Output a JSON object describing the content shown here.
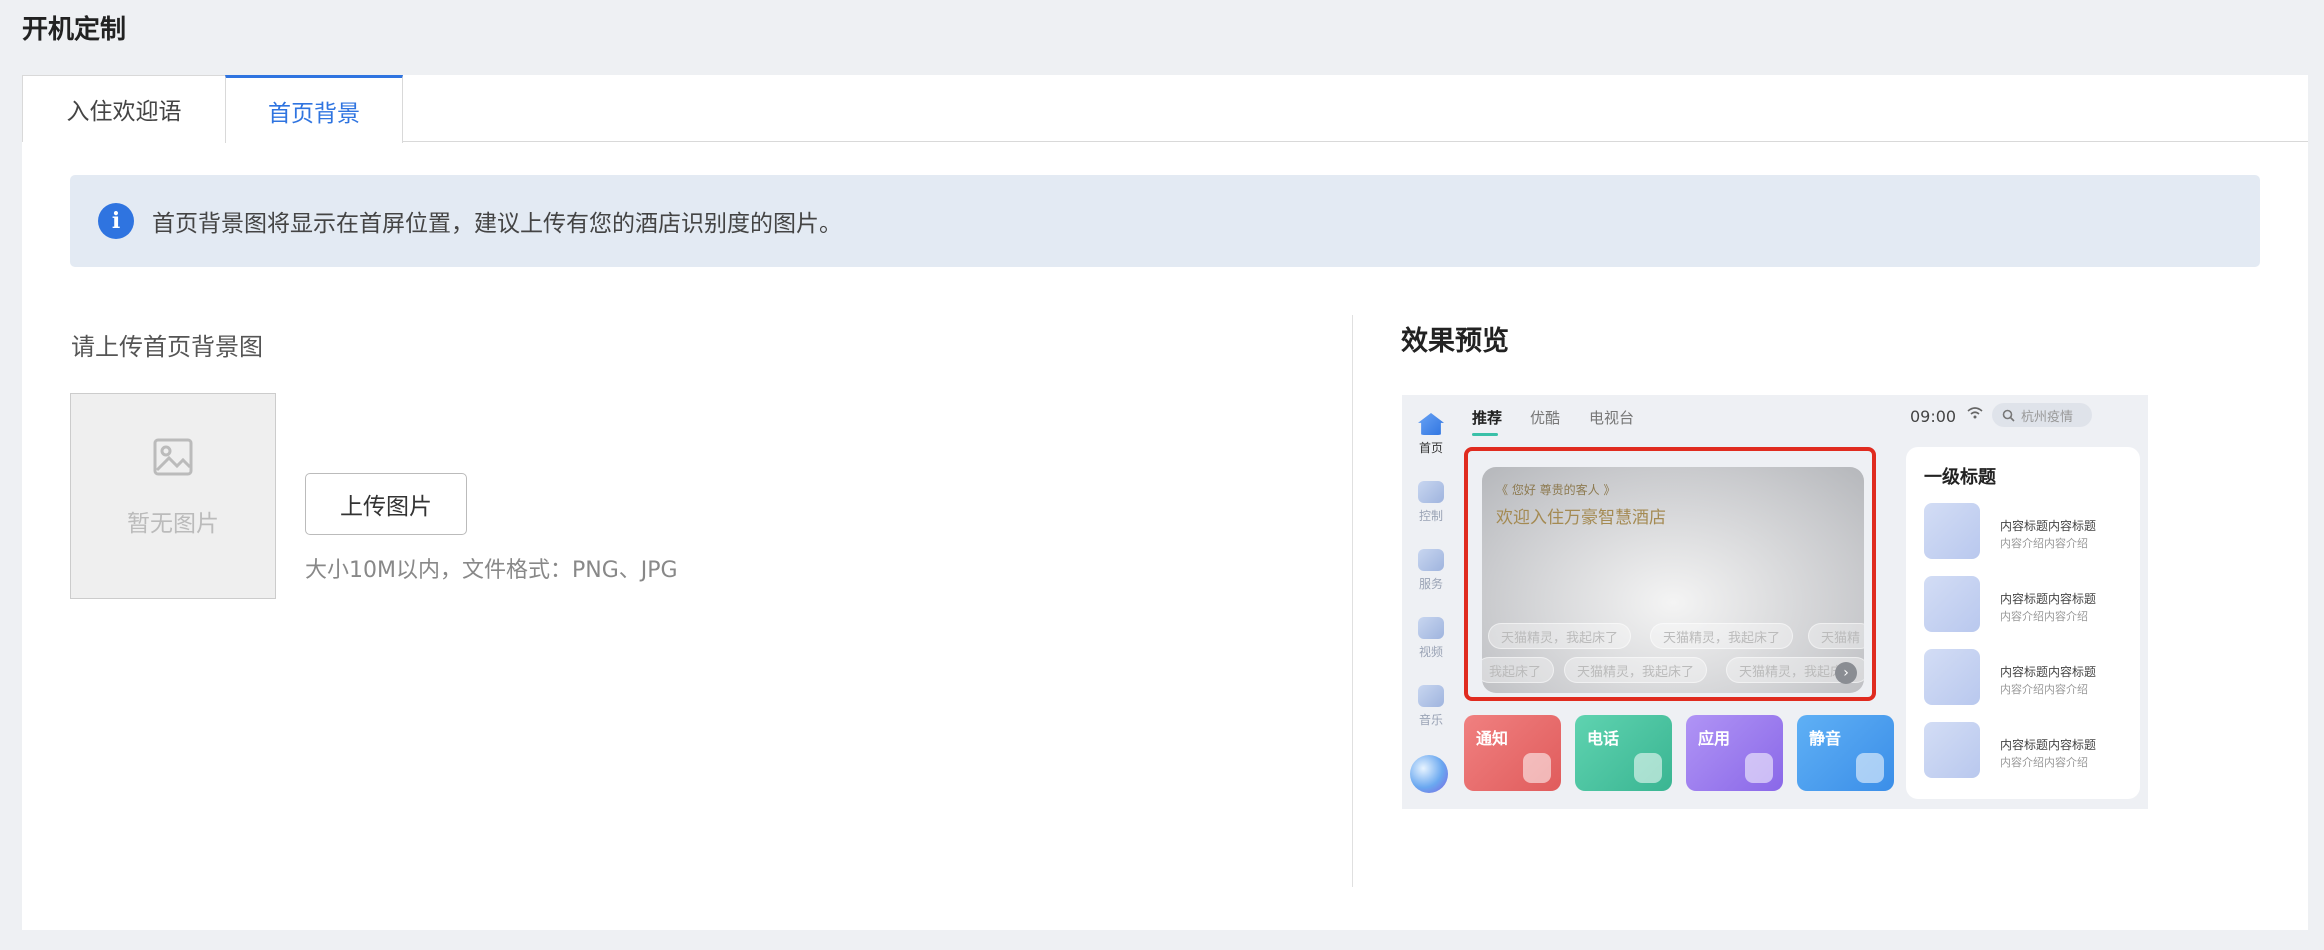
{
  "page": {
    "title": "开机定制"
  },
  "tabs": [
    {
      "label": "入住欢迎语",
      "active": false
    },
    {
      "label": "首页背景",
      "active": true
    }
  ],
  "notice": {
    "icon": "info-icon",
    "text": "首页背景图将显示在首屏位置，建议上传有您的酒店识别度的图片。"
  },
  "upload": {
    "label": "请上传首页背景图",
    "placeholder_text": "暂无图片",
    "button_label": "上传图片",
    "hint": "大小10M以内，文件格式：PNG、JPG"
  },
  "preview": {
    "title": "效果预览",
    "sidebar": [
      {
        "label": "首页",
        "icon": "home-icon"
      },
      {
        "label": "控制",
        "icon": "control-icon"
      },
      {
        "label": "服务",
        "icon": "service-icon"
      },
      {
        "label": "视频",
        "icon": "video-icon"
      },
      {
        "label": "音乐",
        "icon": "music-icon"
      }
    ],
    "top_tabs": [
      "推荐",
      "优酷",
      "电视台"
    ],
    "time": "09:00",
    "search_text": "杭州疫情",
    "banner": {
      "greeting": "《 您好 尊贵的客人 》",
      "welcome": "欢迎入住万豪智慧酒店",
      "chips": [
        "天猫精灵，我起床了",
        "天猫精灵，我起床了",
        "天猫精",
        "我起床了",
        "天猫精灵，我起床了",
        "天猫精灵，我起床了"
      ]
    },
    "tiles": [
      {
        "label": "通知",
        "color": "#e86f6f",
        "icon": "bell-icon"
      },
      {
        "label": "电话",
        "color": "#4fc4a4",
        "icon": "phone-icon"
      },
      {
        "label": "应用",
        "color": "#9b7df0",
        "icon": "apps-icon"
      },
      {
        "label": "静音",
        "color": "#4a9ef0",
        "icon": "mic-icon"
      }
    ],
    "right_panel": {
      "title": "一级标题",
      "items": [
        {
          "title": "内容标题内容标题",
          "desc": "内容介绍内容介绍"
        },
        {
          "title": "内容标题内容标题",
          "desc": "内容介绍内容介绍"
        },
        {
          "title": "内容标题内容标题",
          "desc": "内容介绍内容介绍"
        },
        {
          "title": "内容标题内容标题",
          "desc": "内容介绍内容介绍"
        }
      ]
    }
  }
}
